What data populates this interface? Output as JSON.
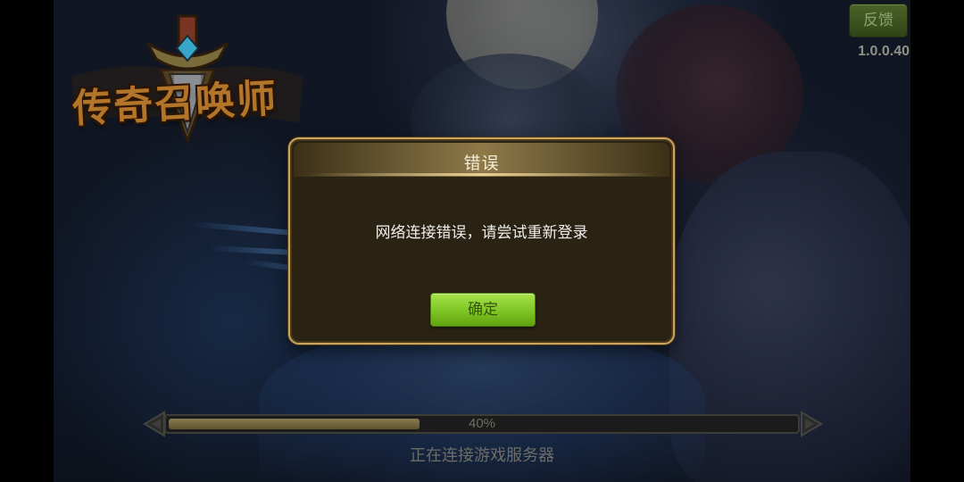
{
  "game": {
    "logo_text": "传奇召唤师"
  },
  "topbar": {
    "feedback_label": "反馈",
    "version": "1.0.0.40"
  },
  "dialog": {
    "title": "错误",
    "message": "网络连接错误，请尝试重新登录",
    "confirm_label": "确定"
  },
  "loading": {
    "progress": 0.4,
    "progress_text": "40%",
    "status": "正在连接游戏服务器"
  },
  "colors": {
    "dialog_border": "#caa460",
    "dialog_bg": "#2a2313",
    "confirm_button": "#7dc423",
    "feedback_button": "#3f5620",
    "progress_fill": "#7a6d43"
  },
  "icons": {
    "logo_emblem": "sword-shield-emblem-icon",
    "progress_left_cap": "arrow-left-cap-icon",
    "progress_right_cap": "arrow-right-cap-icon"
  }
}
